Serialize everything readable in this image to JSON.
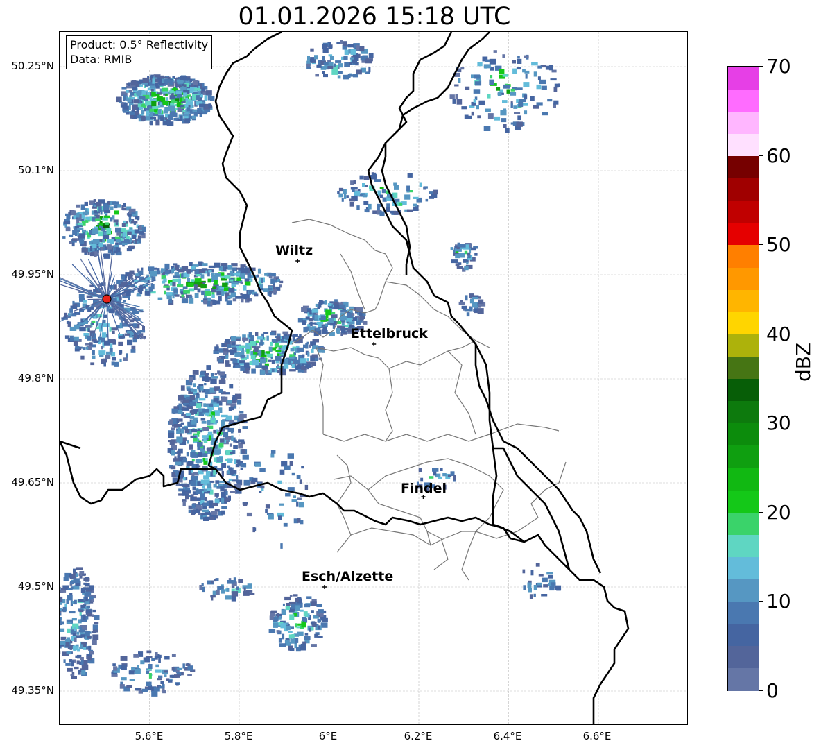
{
  "title": "01.01.2026 15:18 UTC",
  "info": {
    "product": "Product: 0.5° Reflectivity",
    "data": "Data: RMIB"
  },
  "axes": {
    "lat_labels": [
      "50.25°N",
      "50.1°N",
      "49.95°N",
      "49.8°N",
      "49.65°N",
      "49.5°N",
      "49.35°N"
    ],
    "lon_labels": [
      "5.6°E",
      "5.8°E",
      "6°E",
      "6.2°E",
      "6.4°E",
      "6.6°E"
    ]
  },
  "cities": [
    {
      "name": "Wiltz",
      "lat": 49.97,
      "lon": 5.93
    },
    {
      "name": "Ettelbruck",
      "lat": 49.85,
      "lon": 6.1
    },
    {
      "name": "Findel",
      "lat": 49.63,
      "lon": 6.21
    },
    {
      "name": "Esch/Alzette",
      "lat": 49.5,
      "lon": 5.99
    }
  ],
  "radar_site": {
    "lat": 49.915,
    "lon": 5.505,
    "color": "#e8231a"
  },
  "colorbar": {
    "label": "dBZ",
    "ticks": [
      "0",
      "10",
      "20",
      "30",
      "40",
      "50",
      "60",
      "70"
    ],
    "colors": [
      "#6576a6",
      "#53659a",
      "#4565a1",
      "#4a78b0",
      "#5697c2",
      "#63bcda",
      "#5fd6c2",
      "#3ad36a",
      "#14c818",
      "#11b812",
      "#0f9f10",
      "#0c8c0c",
      "#0d7a0d",
      "#075e07",
      "#467514",
      "#adb20b",
      "#ffd500",
      "#ffb500",
      "#ff9800",
      "#ff7f00",
      "#e50000",
      "#c00000",
      "#a00000",
      "#760000",
      "#ffe0ff",
      "#ffb6ff",
      "#ff6cff",
      "#e63fe6"
    ]
  }
}
